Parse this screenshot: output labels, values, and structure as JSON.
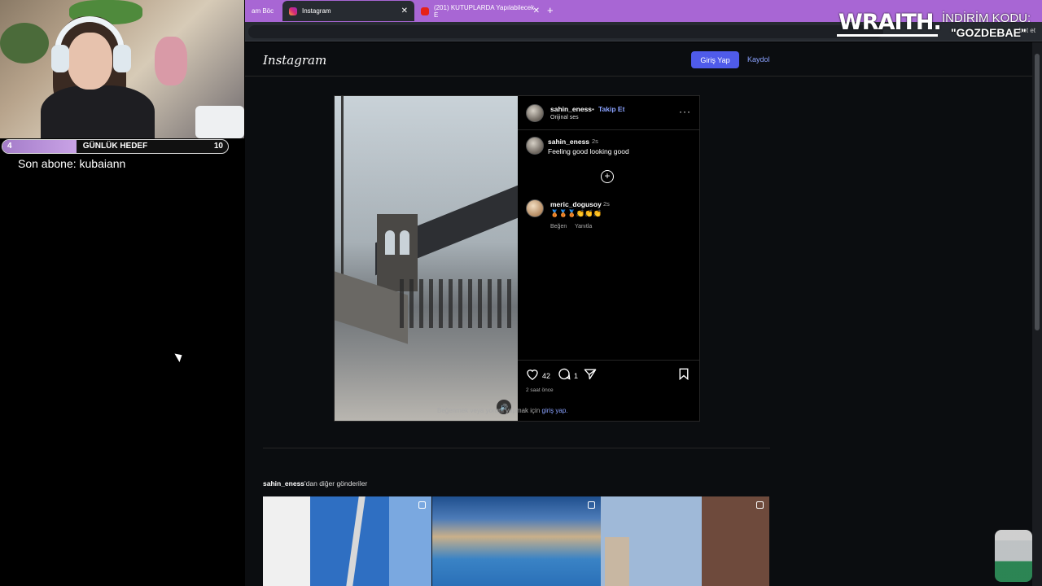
{
  "stream": {
    "goal": {
      "min": "4",
      "title": "GÜNLÜK HEDEF",
      "max": "10",
      "progress": 0.33
    },
    "last_subscriber": "Son abone: kubaiann",
    "sponsor": {
      "brand": "WRAITH.",
      "promo_label": "İNDİRİM KODU:",
      "promo_code": "\"GOZDEBAE\""
    }
  },
  "browser": {
    "tabs": [
      {
        "label": "am Böc",
        "active": false
      },
      {
        "label": "Instagram",
        "active": true
      },
      {
        "label": "(201) KUTUPLARDA Yapılabilecek E",
        "active": false
      }
    ],
    "new_tab": "+",
    "extension_text": "bet et"
  },
  "instagram": {
    "logo": "Instagram",
    "login_button": "Giriş Yap",
    "signup_link": "Kaydol",
    "post": {
      "author": "sahin_eness",
      "separator": "•",
      "follow": "Takip Et",
      "audio": "Orijinal ses",
      "more": "···",
      "caption": {
        "user": "sahin_eness",
        "time": "2s",
        "text": "Feeling good looking good"
      },
      "expand": "+",
      "comment": {
        "user": "meric_dogusoy",
        "time": "2s",
        "text": "🥉🥉🥉👏👏👏",
        "like": "Beğen",
        "reply": "Yanıtla"
      },
      "likes": "42",
      "comments": "1",
      "age": "2 saat önce",
      "login_prompt": "Beğenmek veya yorum yapmak için ",
      "login_prompt_link": "giriş yap."
    },
    "more_posts": {
      "user": "sahin_eness",
      "suffix": "'dan diğer gönderiler"
    }
  }
}
